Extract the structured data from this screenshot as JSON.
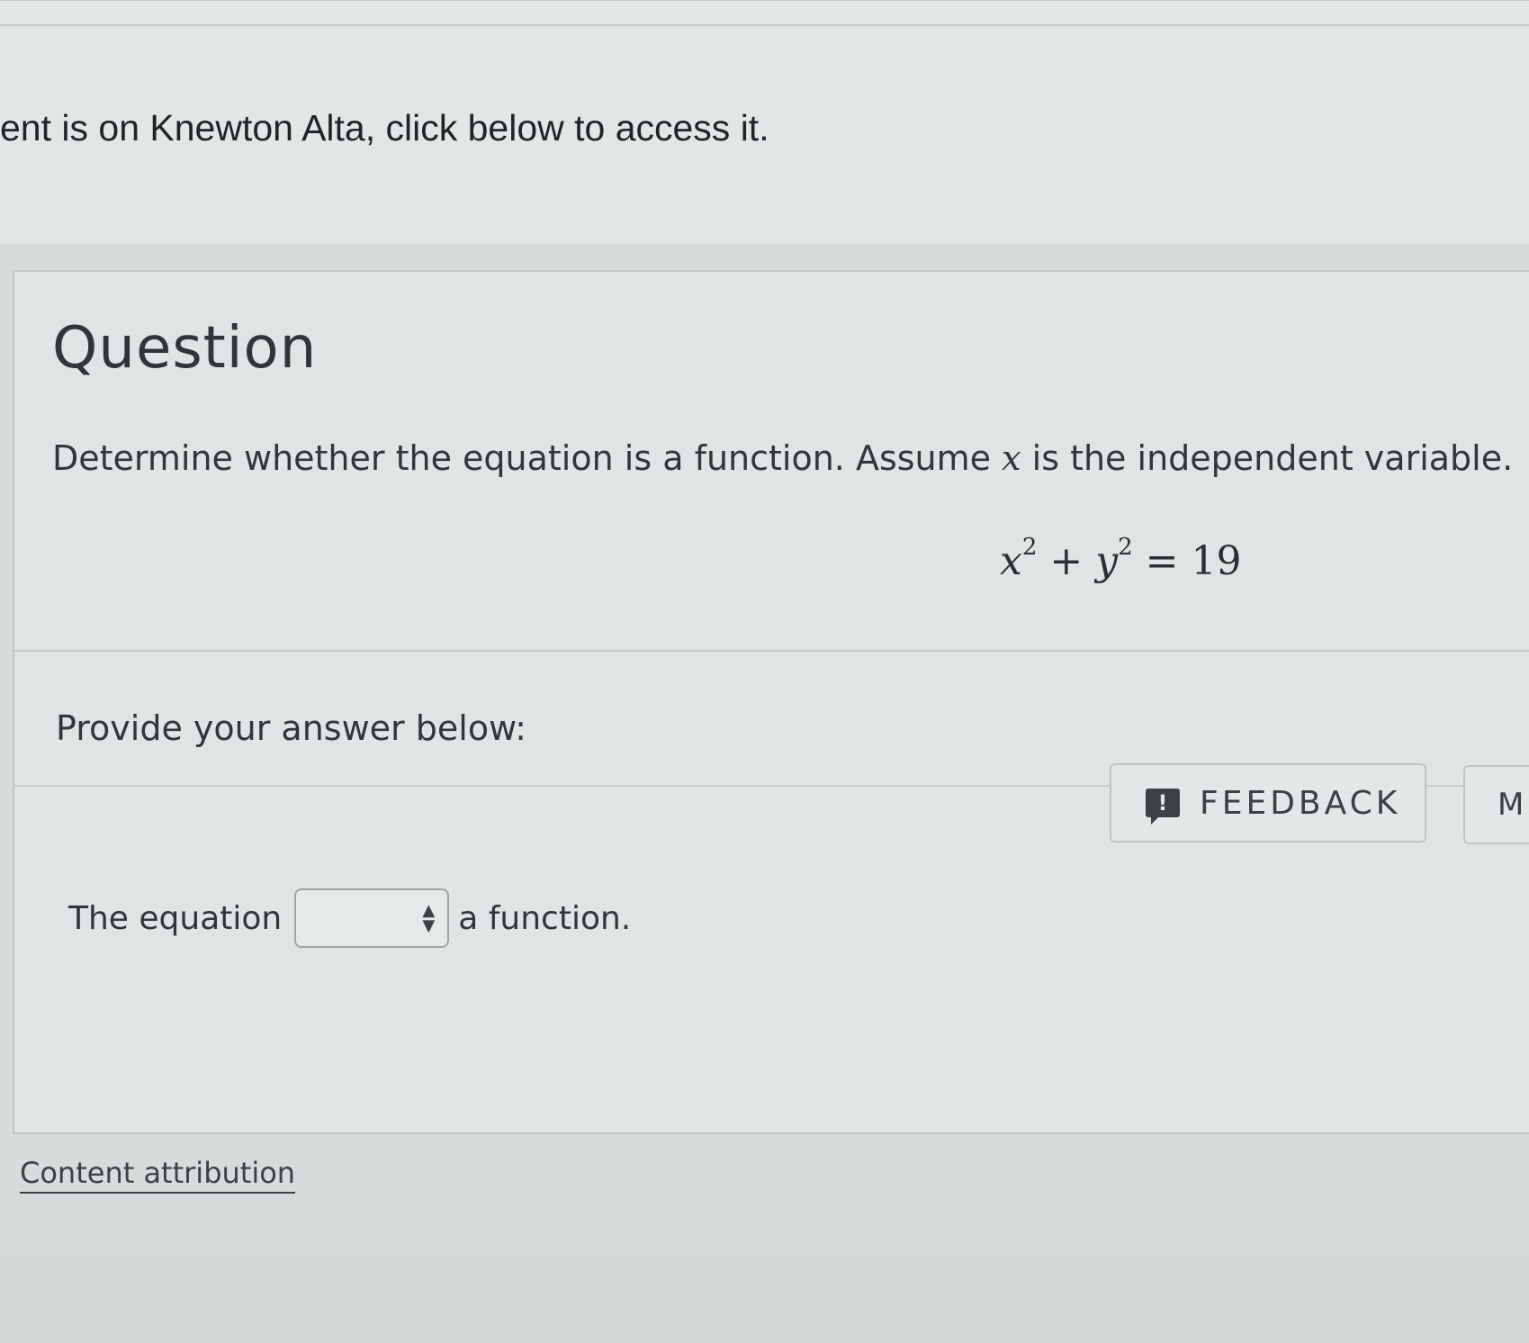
{
  "notice": {
    "text": "ent is on Knewton Alta, click below to access it."
  },
  "question": {
    "title": "Question",
    "prompt_before": "Determine whether the equation is a function. Assume ",
    "prompt_var": "x",
    "prompt_after": " is the independent variable.",
    "equation": {
      "x": "x",
      "x_exp": "2",
      "plus": " + ",
      "y": "y",
      "y_exp": "2",
      "rhs": " = 19"
    }
  },
  "answer": {
    "label": "Provide your answer below:",
    "sentence_before": "The equation",
    "sentence_after": "a function.",
    "select_value": ""
  },
  "buttons": {
    "feedback_icon": "!",
    "feedback_label": "FEEDBACK",
    "more_label": "M"
  },
  "footer": {
    "attribution": "Content attribution"
  },
  "icons": {
    "feedback": "exclamation-speech-bubble-icon",
    "select": "up-down-arrows-icon"
  }
}
